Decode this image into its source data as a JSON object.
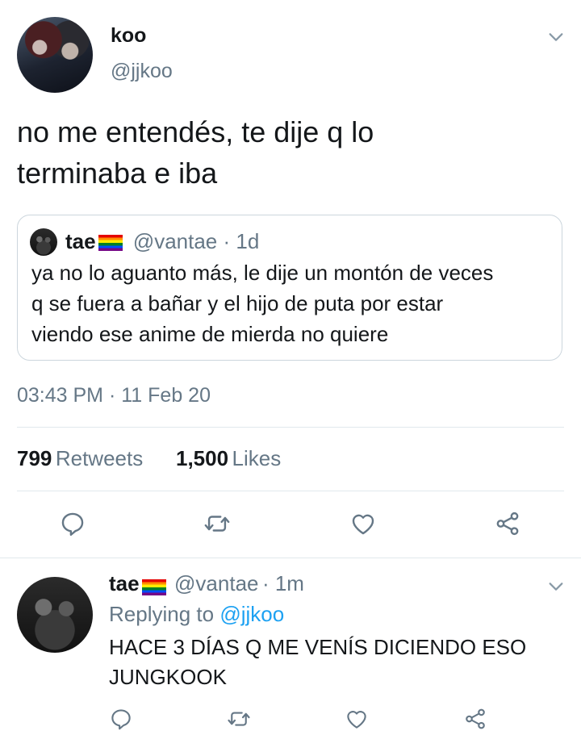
{
  "tweet": {
    "author_name": "koo",
    "author_handle": "@jjkoo",
    "text_line1": "no me entendés, te dije q lo",
    "text_line2": "terminaba e iba",
    "quote": {
      "author_name": "tae",
      "author_handle": "@vantae",
      "age": "· 1d",
      "text_line1": "ya no lo aguanto más, le dije un montón de veces",
      "text_line2": "q se fuera a bañar y el hijo de puta por estar",
      "text_line3": "viendo ese anime de mierda no quiere"
    },
    "time": "03:43 PM",
    "date": "· 11 Feb 20",
    "retweets_count": "799",
    "retweets_label": "Retweets",
    "likes_count": "1,500",
    "likes_label": "Likes"
  },
  "reply": {
    "author_name": "tae",
    "author_handle": "@vantae",
    "age": "· 1m",
    "replying_prefix": "Replying to",
    "replying_handle": "@jjkoo",
    "text_line1": "HACE 3 DÍAS Q ME VENÍS DICIENDO ESO",
    "text_line2": "JUNGKOOK"
  },
  "icons": [
    "chevron-down-icon",
    "reply-icon",
    "retweet-icon",
    "like-icon",
    "share-icon",
    "rainbow-flag-icon"
  ],
  "colors": {
    "link": "#1da1f2",
    "secondary_text": "#657786",
    "divider": "#e1e8ed"
  }
}
